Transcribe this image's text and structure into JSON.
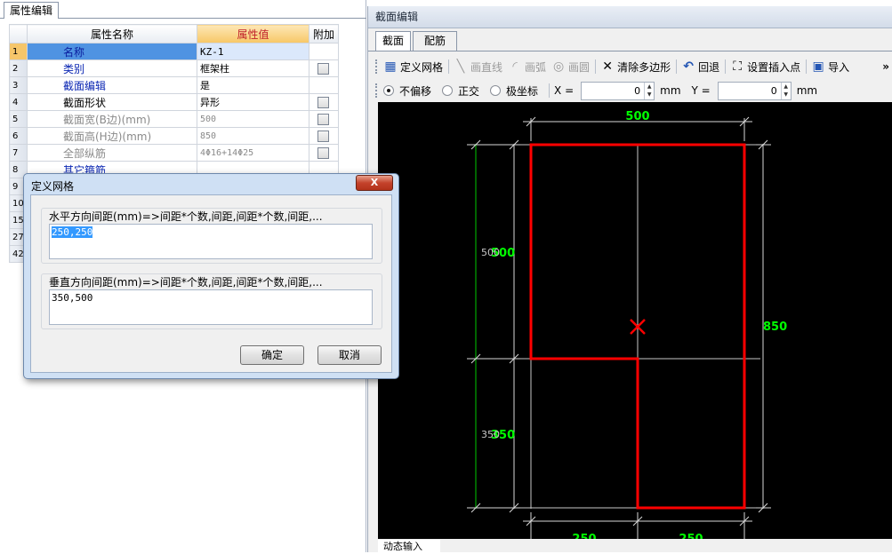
{
  "left_panel": {
    "tab": "属性编辑",
    "headers": {
      "name": "属性名称",
      "value": "属性值",
      "extra": "附加"
    },
    "rows": [
      {
        "num": "1",
        "name": "名称",
        "value": "KZ-1"
      },
      {
        "num": "2",
        "name": "类别",
        "value": "框架柱"
      },
      {
        "num": "3",
        "name": "截面编辑",
        "value": "是"
      },
      {
        "num": "4",
        "name": "截面形状",
        "value": "异形"
      },
      {
        "num": "5",
        "name": "截面宽(B边)(mm)",
        "value": "500"
      },
      {
        "num": "6",
        "name": "截面高(H边)(mm)",
        "value": "850"
      },
      {
        "num": "7",
        "name": "全部纵筋",
        "value": "4Φ16+14Φ25"
      },
      {
        "num": "8",
        "name": "其它箍筋",
        "value": ""
      },
      {
        "num": "9",
        "name": "",
        "value": ""
      },
      {
        "num": "10",
        "name": "",
        "value": ""
      },
      {
        "num": "15",
        "name": "",
        "value": ""
      },
      {
        "num": "27",
        "name": "",
        "value": ""
      },
      {
        "num": "42",
        "name": "",
        "value": ""
      }
    ]
  },
  "section_editor": {
    "title": "截面编辑",
    "tabs": [
      "截面",
      "配筋"
    ],
    "toolbar": {
      "define_grid": "定义网格",
      "draw_line": "画直线",
      "draw_arc": "画弧",
      "draw_circle": "画圆",
      "clear_polygon": "清除多边形",
      "undo": "回退",
      "set_insert_point": "设置插入点",
      "import": "导入",
      "more": "»"
    },
    "options": {
      "no_offset": "不偏移",
      "orthogonal": "正交",
      "polar": "极坐标",
      "x_label": "X =",
      "x_value": "0",
      "x_unit": "mm",
      "y_label": "Y =",
      "y_value": "0",
      "y_unit": "mm"
    },
    "dimensions": {
      "top": "500",
      "right": "850",
      "left_upper": "500",
      "left_lower": "350",
      "bottom_left": "250",
      "bottom_right": "250"
    },
    "bottom_tab": "动态输入"
  },
  "dialog": {
    "title": "定义网格",
    "close": "X",
    "horizontal_label": "水平方向间距(mm)=>间距*个数,间距,间距*个数,间距,...",
    "horizontal_value": "250,250",
    "vertical_label": "垂直方向间距(mm)=>间距*个数,间距,间距*个数,间距,...",
    "vertical_value": "350,500",
    "ok": "确定",
    "cancel": "取消"
  },
  "colors": {
    "canvas_bg": "#000000",
    "shape_outline": "#ff0000",
    "dimension": "#00ff00",
    "grid": "#c8c8c8"
  }
}
